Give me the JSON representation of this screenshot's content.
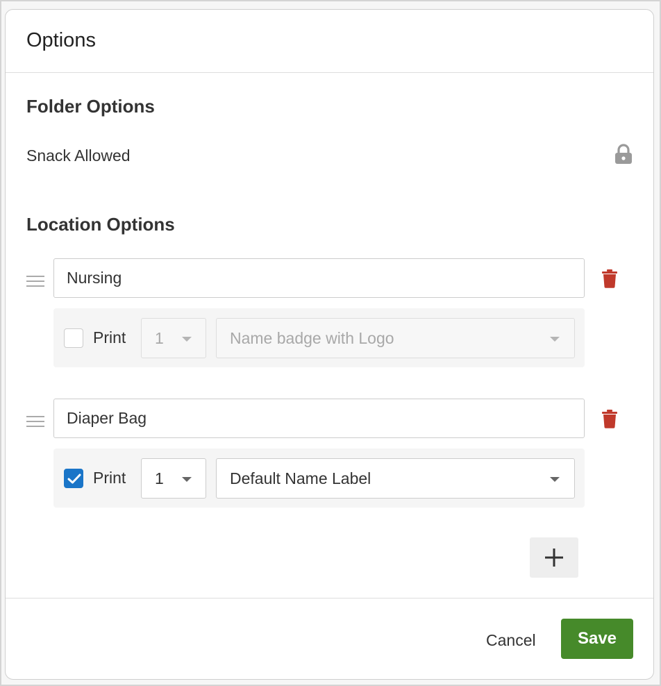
{
  "modal": {
    "title": "Options"
  },
  "folder_options": {
    "title": "Folder Options",
    "items": [
      {
        "label": "Snack Allowed",
        "icon": "lock-icon"
      }
    ]
  },
  "location_options": {
    "title": "Location Options",
    "items": [
      {
        "name": "Nursing",
        "print_label": "Print",
        "print_checked": false,
        "quantity": "1",
        "template": "Name badge with Logo",
        "disabled": true
      },
      {
        "name": "Diaper Bag",
        "print_label": "Print",
        "print_checked": true,
        "quantity": "1",
        "template": "Default Name Label",
        "disabled": false
      }
    ],
    "add_label": "+"
  },
  "footer": {
    "cancel_label": "Cancel",
    "save_label": "Save"
  },
  "colors": {
    "save": "#468a2a",
    "delete": "#c0392b",
    "checkbox_checked": "#1a75c8",
    "lock": "#9a9a9a"
  }
}
